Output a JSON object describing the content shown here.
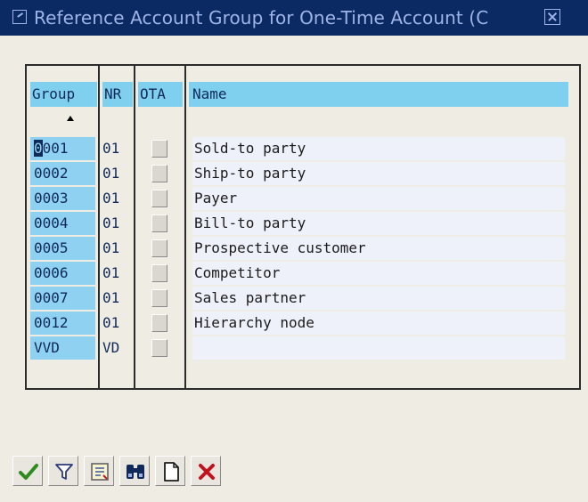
{
  "window": {
    "title": "Reference Account Group for One-Time Account (C"
  },
  "table": {
    "columns": {
      "group": "Group",
      "nr": "NR",
      "ota": "OTA",
      "name": "Name"
    },
    "rows": [
      {
        "group": "0001",
        "nr": "01",
        "name": "Sold-to party"
      },
      {
        "group": "0002",
        "nr": "01",
        "name": "Ship-to party"
      },
      {
        "group": "0003",
        "nr": "01",
        "name": "Payer"
      },
      {
        "group": "0004",
        "nr": "01",
        "name": "Bill-to party"
      },
      {
        "group": "0005",
        "nr": "01",
        "name": "Prospective customer"
      },
      {
        "group": "0006",
        "nr": "01",
        "name": "Competitor"
      },
      {
        "group": "0007",
        "nr": "01",
        "name": "Sales partner"
      },
      {
        "group": "0012",
        "nr": "01",
        "name": "Hierarchy node"
      },
      {
        "group": "VVD",
        "nr": "VD",
        "name": ""
      }
    ]
  },
  "toolbar": {
    "icons": [
      "checkmark-icon",
      "filter-icon",
      "create-entry-icon",
      "find-icon",
      "new-document-icon",
      "cancel-icon"
    ]
  }
}
